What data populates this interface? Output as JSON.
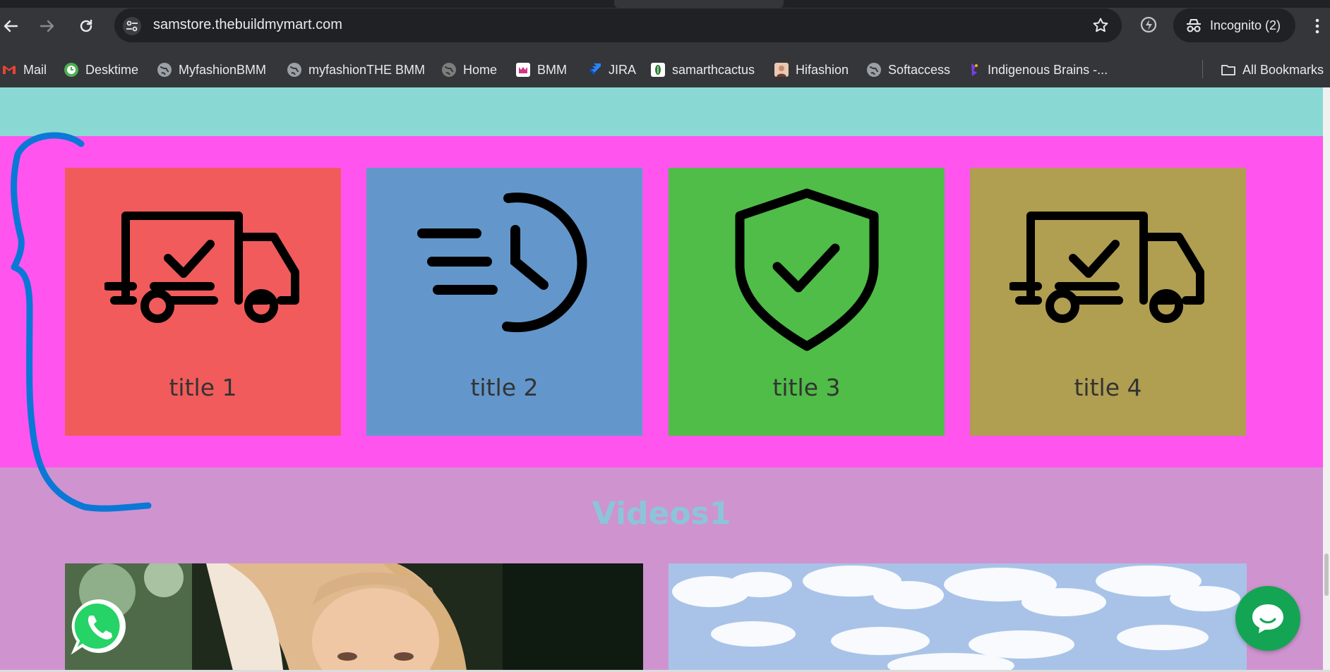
{
  "browser": {
    "url": "samstore.thebuildmymart.com",
    "incognito_label": "Incognito (2)",
    "bookmarks": [
      {
        "label": "Mail",
        "icon": "gmail-icon",
        "color": "#ea4335"
      },
      {
        "label": "Desktime",
        "icon": "desktime-icon",
        "color": "#4caf50"
      },
      {
        "label": "MyfashionBMM",
        "icon": "globe-icon",
        "color": "#9aa0a6"
      },
      {
        "label": "myfashionTHE BMM",
        "icon": "globe-icon",
        "color": "#9aa0a6"
      },
      {
        "label": "Home",
        "icon": "globe-icon",
        "color": "#7d7d7d"
      },
      {
        "label": "BMM",
        "icon": "bmm-icon",
        "color": "#d63384"
      },
      {
        "label": "JIRA",
        "icon": "jira-icon",
        "color": "#2684ff"
      },
      {
        "label": "samarthcactus",
        "icon": "cactus-icon",
        "color": "#2e7d32"
      },
      {
        "label": "Hifashion",
        "icon": "hifashion-icon",
        "color": "#c98b6b"
      },
      {
        "label": "Softaccess",
        "icon": "globe-icon",
        "color": "#9aa0a6"
      },
      {
        "label": "Indigenous Brains -...",
        "icon": "indigenous-icon",
        "color": "#7b3fe4"
      }
    ],
    "all_bookmarks_label": "All Bookmarks"
  },
  "features": {
    "cards": [
      {
        "title": "title 1",
        "icon": "delivery-truck-icon",
        "bg": "#f15b5b"
      },
      {
        "title": "title 2",
        "icon": "fast-clock-icon",
        "bg": "#6397cc"
      },
      {
        "title": "title 3",
        "icon": "shield-check-icon",
        "bg": "#4fbd48"
      },
      {
        "title": "title 4",
        "icon": "delivery-truck-icon",
        "bg": "#b09e51"
      }
    ]
  },
  "videos": {
    "title": "Videos1"
  },
  "colors": {
    "teal_band": "#8ad8d4",
    "pink_section": "#ff55ee",
    "mauve_section": "#cf93cf",
    "annotation_stroke": "#0a78d6",
    "chat_button": "#13a554"
  }
}
